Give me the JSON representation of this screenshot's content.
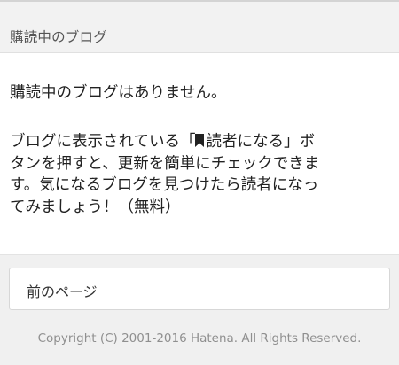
{
  "header": {
    "title": "購読中のブログ"
  },
  "main": {
    "empty_message": "購読中のブログはありません。",
    "description": {
      "line1_before_icon": "ブログに表示されている「",
      "line1_after_icon": "読者になる」ボ",
      "line2": "タンを押すと、更新を簡単にチェックできま",
      "line3": "す。気になるブログを見つけたら読者になっ",
      "line4": "てみましょう！（無料）"
    },
    "bookmark_icon": "bookmark-icon"
  },
  "footer": {
    "prev_page_label": "前のページ",
    "copyright": "Copyright (C) 2001-2016 Hatena. All Rights Reserved."
  },
  "colors": {
    "background": "#f0f0f0",
    "card": "#ffffff",
    "text": "#222222",
    "muted": "#8f8f8f"
  }
}
